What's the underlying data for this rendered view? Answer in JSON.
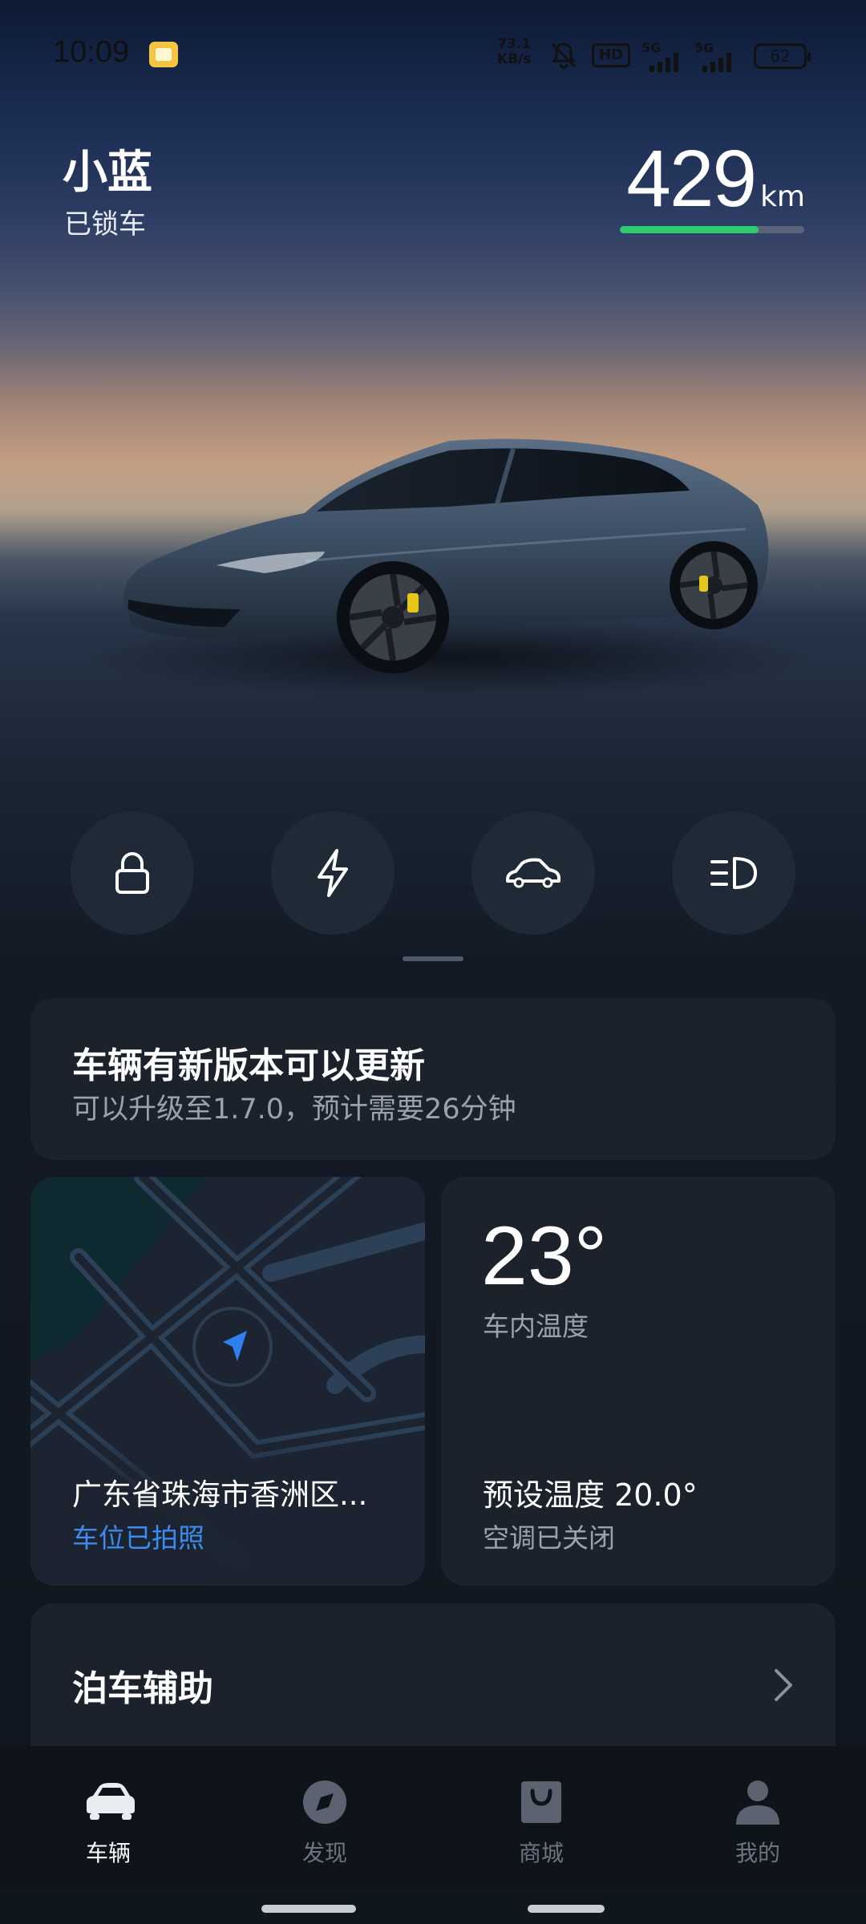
{
  "status_bar": {
    "time": "10:09",
    "net_speed_value": "73.1",
    "net_speed_unit": "KB/s",
    "hd_label": "HD",
    "sim1_label": "5G",
    "sim2_label": "5G",
    "battery": "62"
  },
  "vehicle": {
    "name": "小蓝",
    "lock_status": "已锁车",
    "range_value": "429",
    "range_unit": "km",
    "battery_fraction": 0.75
  },
  "quick_controls": [
    {
      "icon": "lock-icon"
    },
    {
      "icon": "charge-icon"
    },
    {
      "icon": "trunk-icon"
    },
    {
      "icon": "headlight-icon"
    }
  ],
  "update_card": {
    "title": "车辆有新版本可以更新",
    "subtitle": "可以升级至1.7.0，预计需要26分钟"
  },
  "location_card": {
    "address": "广东省珠海市香洲区...",
    "status": "车位已拍照"
  },
  "climate_card": {
    "temp": "23°",
    "temp_label": "车内温度",
    "preset": "预设温度 20.0°",
    "ac_status": "空调已关闭"
  },
  "parking_card": {
    "title": "泊车辅助"
  },
  "bottom_nav": {
    "items": [
      {
        "label": "车辆",
        "icon": "car-icon",
        "active": true
      },
      {
        "label": "发现",
        "icon": "compass-icon",
        "active": false
      },
      {
        "label": "商城",
        "icon": "shopping-bag-icon",
        "active": false
      },
      {
        "label": "我的",
        "icon": "profile-icon",
        "active": false
      }
    ]
  },
  "colors": {
    "accent_green": "#2ecc71",
    "accent_blue": "#3e8bf0",
    "card_bg": "#1c222b"
  }
}
